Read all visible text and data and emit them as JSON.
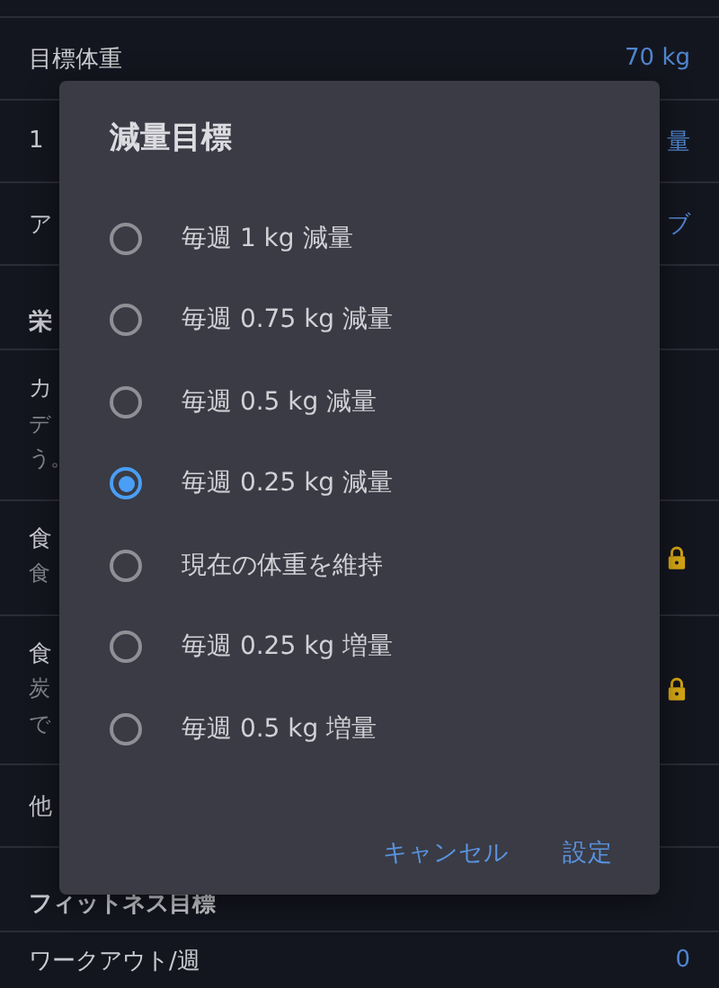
{
  "settings_list": [
    {
      "kind": "value",
      "label": "目標体重",
      "value": "70 kg"
    },
    {
      "kind": "value",
      "label": "1",
      "value": "量"
    },
    {
      "kind": "value",
      "label": "ア",
      "value": "ブ"
    },
    {
      "kind": "header",
      "label": "栄"
    },
    {
      "kind": "detail",
      "label": "カ",
      "lines": [
        "デ",
        "う。"
      ],
      "locked": false
    },
    {
      "kind": "detail",
      "label": "食",
      "lines": [
        "食"
      ],
      "locked": true
    },
    {
      "kind": "detail",
      "label": "食",
      "lines": [
        "炭",
        "で"
      ],
      "locked": true
    },
    {
      "kind": "value",
      "label": "他"
    },
    {
      "kind": "header",
      "label": "フィットネス目標"
    },
    {
      "kind": "value",
      "label": "ワークアウト/週",
      "value": "0"
    }
  ],
  "dialog": {
    "title": "減量目標",
    "options": [
      {
        "label": "毎週 1 kg 減量",
        "selected": false
      },
      {
        "label": "毎週 0.75 kg 減量",
        "selected": false
      },
      {
        "label": "毎週 0.5 kg 減量",
        "selected": false
      },
      {
        "label": "毎週 0.25 kg 減量",
        "selected": true
      },
      {
        "label": "現在の体重を維持",
        "selected": false
      },
      {
        "label": "毎週 0.25 kg 増量",
        "selected": false
      },
      {
        "label": "毎週 0.5 kg 増量",
        "selected": false
      }
    ],
    "buttons": [
      "キャンセル",
      "設定"
    ]
  }
}
